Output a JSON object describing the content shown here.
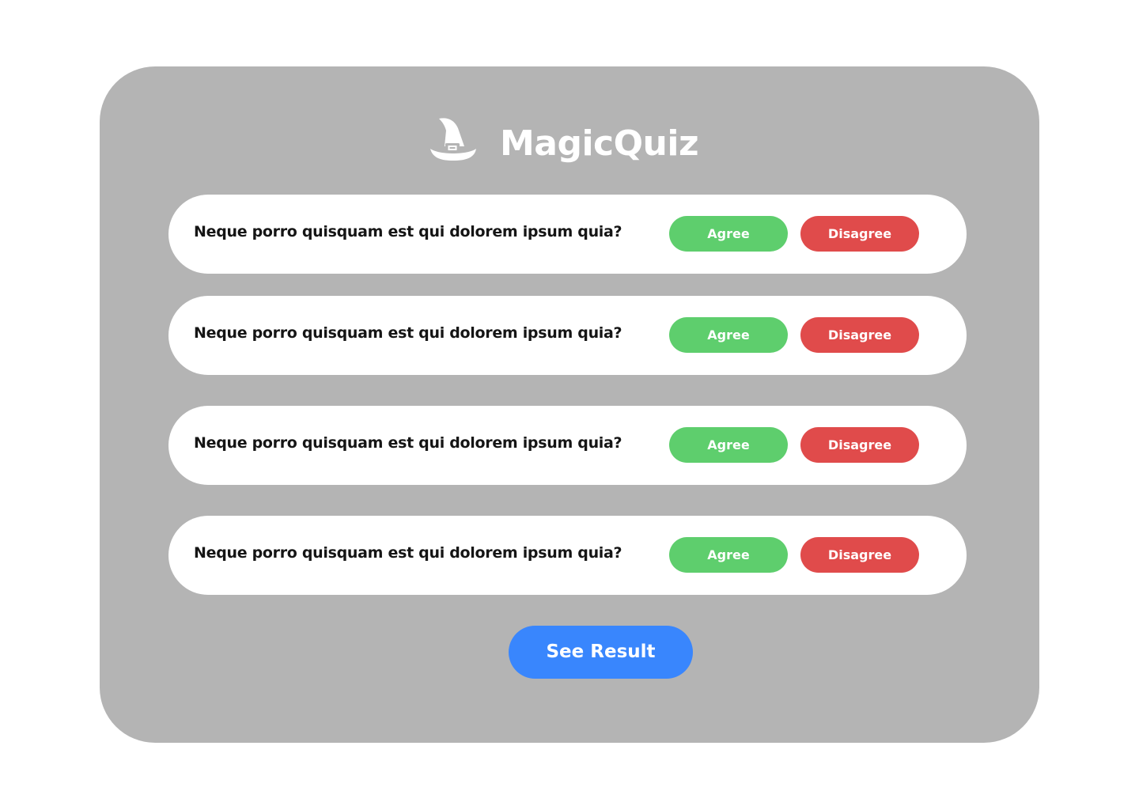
{
  "app": {
    "name": "MagicQuiz",
    "logo_icon": "wizard-hat-icon"
  },
  "questions": [
    {
      "text": "Neque porro quisquam est qui dolorem ipsum quia?",
      "agree_label": "Agree",
      "disagree_label": "Disagree"
    },
    {
      "text": "Neque porro quisquam est qui dolorem ipsum quia?",
      "agree_label": "Agree",
      "disagree_label": "Disagree"
    },
    {
      "text": "Neque porro quisquam est qui dolorem ipsum quia?",
      "agree_label": "Agree",
      "disagree_label": "Disagree"
    },
    {
      "text": "Neque porro quisquam est qui dolorem ipsum quia?",
      "agree_label": "Agree",
      "disagree_label": "Disagree"
    }
  ],
  "actions": {
    "see_result_label": "See Result"
  },
  "colors": {
    "panel": "#b4b4b4",
    "agree": "#5ece6d",
    "disagree": "#e04b4b",
    "primary": "#3986fd",
    "text": "#151515"
  }
}
